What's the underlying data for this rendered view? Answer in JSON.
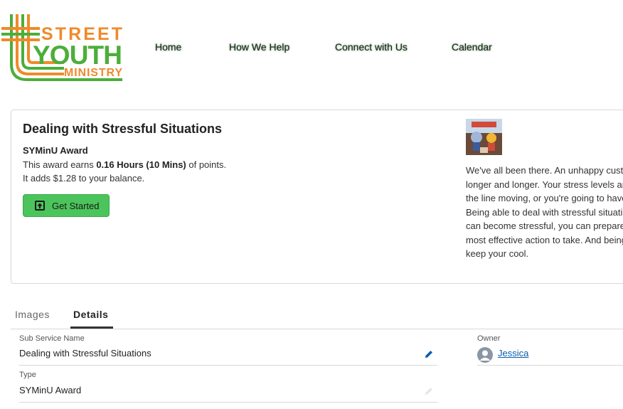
{
  "header": {
    "logo": {
      "line1": "STREET",
      "line2": "YOUTH",
      "line3": "MINISTRY",
      "colors": {
        "orange": "#ef8a2a",
        "green": "#4cae3a"
      }
    },
    "nav": [
      {
        "label": "Home"
      },
      {
        "label": "How We Help"
      },
      {
        "label": "Connect with Us"
      },
      {
        "label": "Calendar"
      }
    ]
  },
  "award": {
    "title": "Dealing with Stressful Situations",
    "type": "SYMinU Award",
    "earn_prefix": "This award earns ",
    "earn_bold": "0.16 Hours (10 Mins)",
    "earn_suffix": " of points.",
    "balance": "It adds $1.28 to your balance.",
    "button_label": "Get Started",
    "button_icon": "launch-icon",
    "description_lines": [
      "We've all been there. An unhappy custo",
      "longer and longer. Your stress levels are",
      "the line moving, or you're going to have",
      "Being able to deal with stressful situati",
      "can become stressful, you can prepare f",
      "most effective action to take. And being",
      "keep your cool."
    ]
  },
  "tabs": [
    {
      "label": "Images"
    },
    {
      "label": "Details"
    }
  ],
  "details": {
    "sub_service_label": "Sub Service Name",
    "sub_service_value": "Dealing with Stressful Situations",
    "type_label": "Type",
    "type_value": "SYMinU Award",
    "owner_label": "Owner",
    "owner_value": "Jessica"
  },
  "colors": {
    "accent_green": "#4bc55b",
    "link_blue": "#0b5cab",
    "edit_blue": "#0b5cab"
  }
}
